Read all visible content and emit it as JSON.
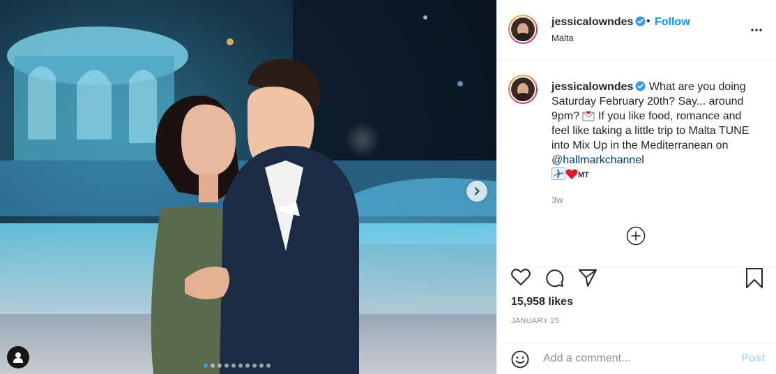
{
  "post": {
    "username": "jessicalowndes",
    "verified": true,
    "follow_label": "Follow",
    "separator": "•",
    "location": "Malta"
  },
  "caption": {
    "username": "jessicalowndes",
    "text_part1": "What are you doing Saturday February 20th? Say... around 9pm?",
    "text_part2": "If you like food, romance and feel like taking a little trip to Malta TUNE into Mix Up in the Mediterranean on",
    "mention": "@hallmarkchannel",
    "flag_text": "MT",
    "time_ago": "3w"
  },
  "stats": {
    "likes": "15,958 likes",
    "date": "JANUARY 25"
  },
  "comment": {
    "placeholder": "Add a comment...",
    "post_label": "Post"
  },
  "carousel": {
    "current": 1,
    "total": 10
  },
  "icons": {
    "more": "more-options-icon",
    "like": "heart-icon",
    "comment": "comment-icon",
    "share": "share-icon",
    "save": "bookmark-icon",
    "emoji": "emoji-icon",
    "next": "chevron-right-icon",
    "tags": "user-tag-icon",
    "load_more": "plus-circle-icon"
  },
  "colors": {
    "accent": "#0095f6",
    "verified": "#3897f0",
    "post_disabled": "#b2dffc",
    "muted": "#8e8e8e"
  }
}
